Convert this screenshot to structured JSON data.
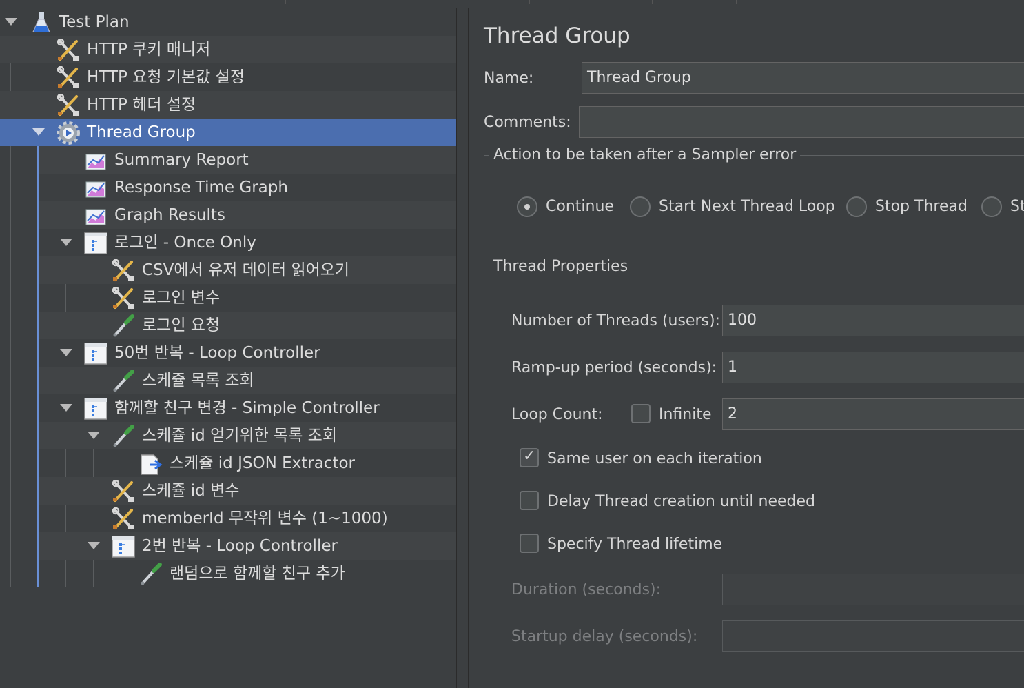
{
  "tree": {
    "items": [
      {
        "label": "Test Plan",
        "icon": "flask-icon"
      },
      {
        "label": "HTTP 쿠키 매니저",
        "icon": "config-tools-icon"
      },
      {
        "label": "HTTP 요청 기본값 설정",
        "icon": "config-tools-icon"
      },
      {
        "label": "HTTP 헤더 설정",
        "icon": "config-tools-icon"
      },
      {
        "label": "Thread Group",
        "icon": "gear-icon"
      },
      {
        "label": "Summary Report",
        "icon": "listener-graph-icon"
      },
      {
        "label": "Response Time Graph",
        "icon": "listener-graph-icon"
      },
      {
        "label": "Graph Results",
        "icon": "listener-graph-icon"
      },
      {
        "label": "로그인 - Once Only",
        "icon": "controller-icon"
      },
      {
        "label": "CSV에서 유저 데이터 읽어오기",
        "icon": "config-tools-icon"
      },
      {
        "label": "로그인 변수",
        "icon": "config-tools-icon"
      },
      {
        "label": "로그인 요청",
        "icon": "sampler-pipette-icon"
      },
      {
        "label": "50번 반복 - Loop Controller",
        "icon": "controller-icon"
      },
      {
        "label": "스케쥴 목록 조회",
        "icon": "sampler-pipette-icon"
      },
      {
        "label": "함께할 친구 변경 - Simple Controller",
        "icon": "controller-icon"
      },
      {
        "label": "스케쥴 id 얻기위한 목록 조회",
        "icon": "sampler-pipette-icon"
      },
      {
        "label": "스케쥴 id JSON Extractor",
        "icon": "extractor-icon"
      },
      {
        "label": "스케쥴 id 변수",
        "icon": "config-tools-icon"
      },
      {
        "label": "memberId 무작위 변수 (1~1000)",
        "icon": "config-tools-icon"
      },
      {
        "label": "2번 반복 - Loop Controller",
        "icon": "controller-icon"
      },
      {
        "label": "랜덤으로 함께할 친구 추가",
        "icon": "sampler-pipette-icon"
      }
    ]
  },
  "panel": {
    "title": "Thread Group",
    "name_label": "Name:",
    "name_value": "Thread Group",
    "comments_label": "Comments:",
    "comments_value": "",
    "sampler_error_section": "Action to be taken after a Sampler error",
    "radio_options": [
      "Continue",
      "Start Next Thread Loop",
      "Stop Thread",
      "St"
    ],
    "selected_radio": "Continue",
    "thread_properties_section": "Thread Properties",
    "threads_label": "Number of Threads (users):",
    "threads_value": "100",
    "rampup_label": "Ramp-up period (seconds):",
    "rampup_value": "1",
    "loop_label": "Loop Count:",
    "infinite_label": "Infinite",
    "infinite_checked": false,
    "loop_value": "2",
    "same_user_label": "Same user on each iteration",
    "same_user_checked": true,
    "delay_label": "Delay Thread creation until needed",
    "delay_checked": false,
    "lifetime_label": "Specify Thread lifetime",
    "lifetime_checked": false,
    "duration_label": "Duration (seconds):",
    "duration_value": "",
    "startup_label": "Startup delay (seconds):",
    "startup_value": ""
  }
}
